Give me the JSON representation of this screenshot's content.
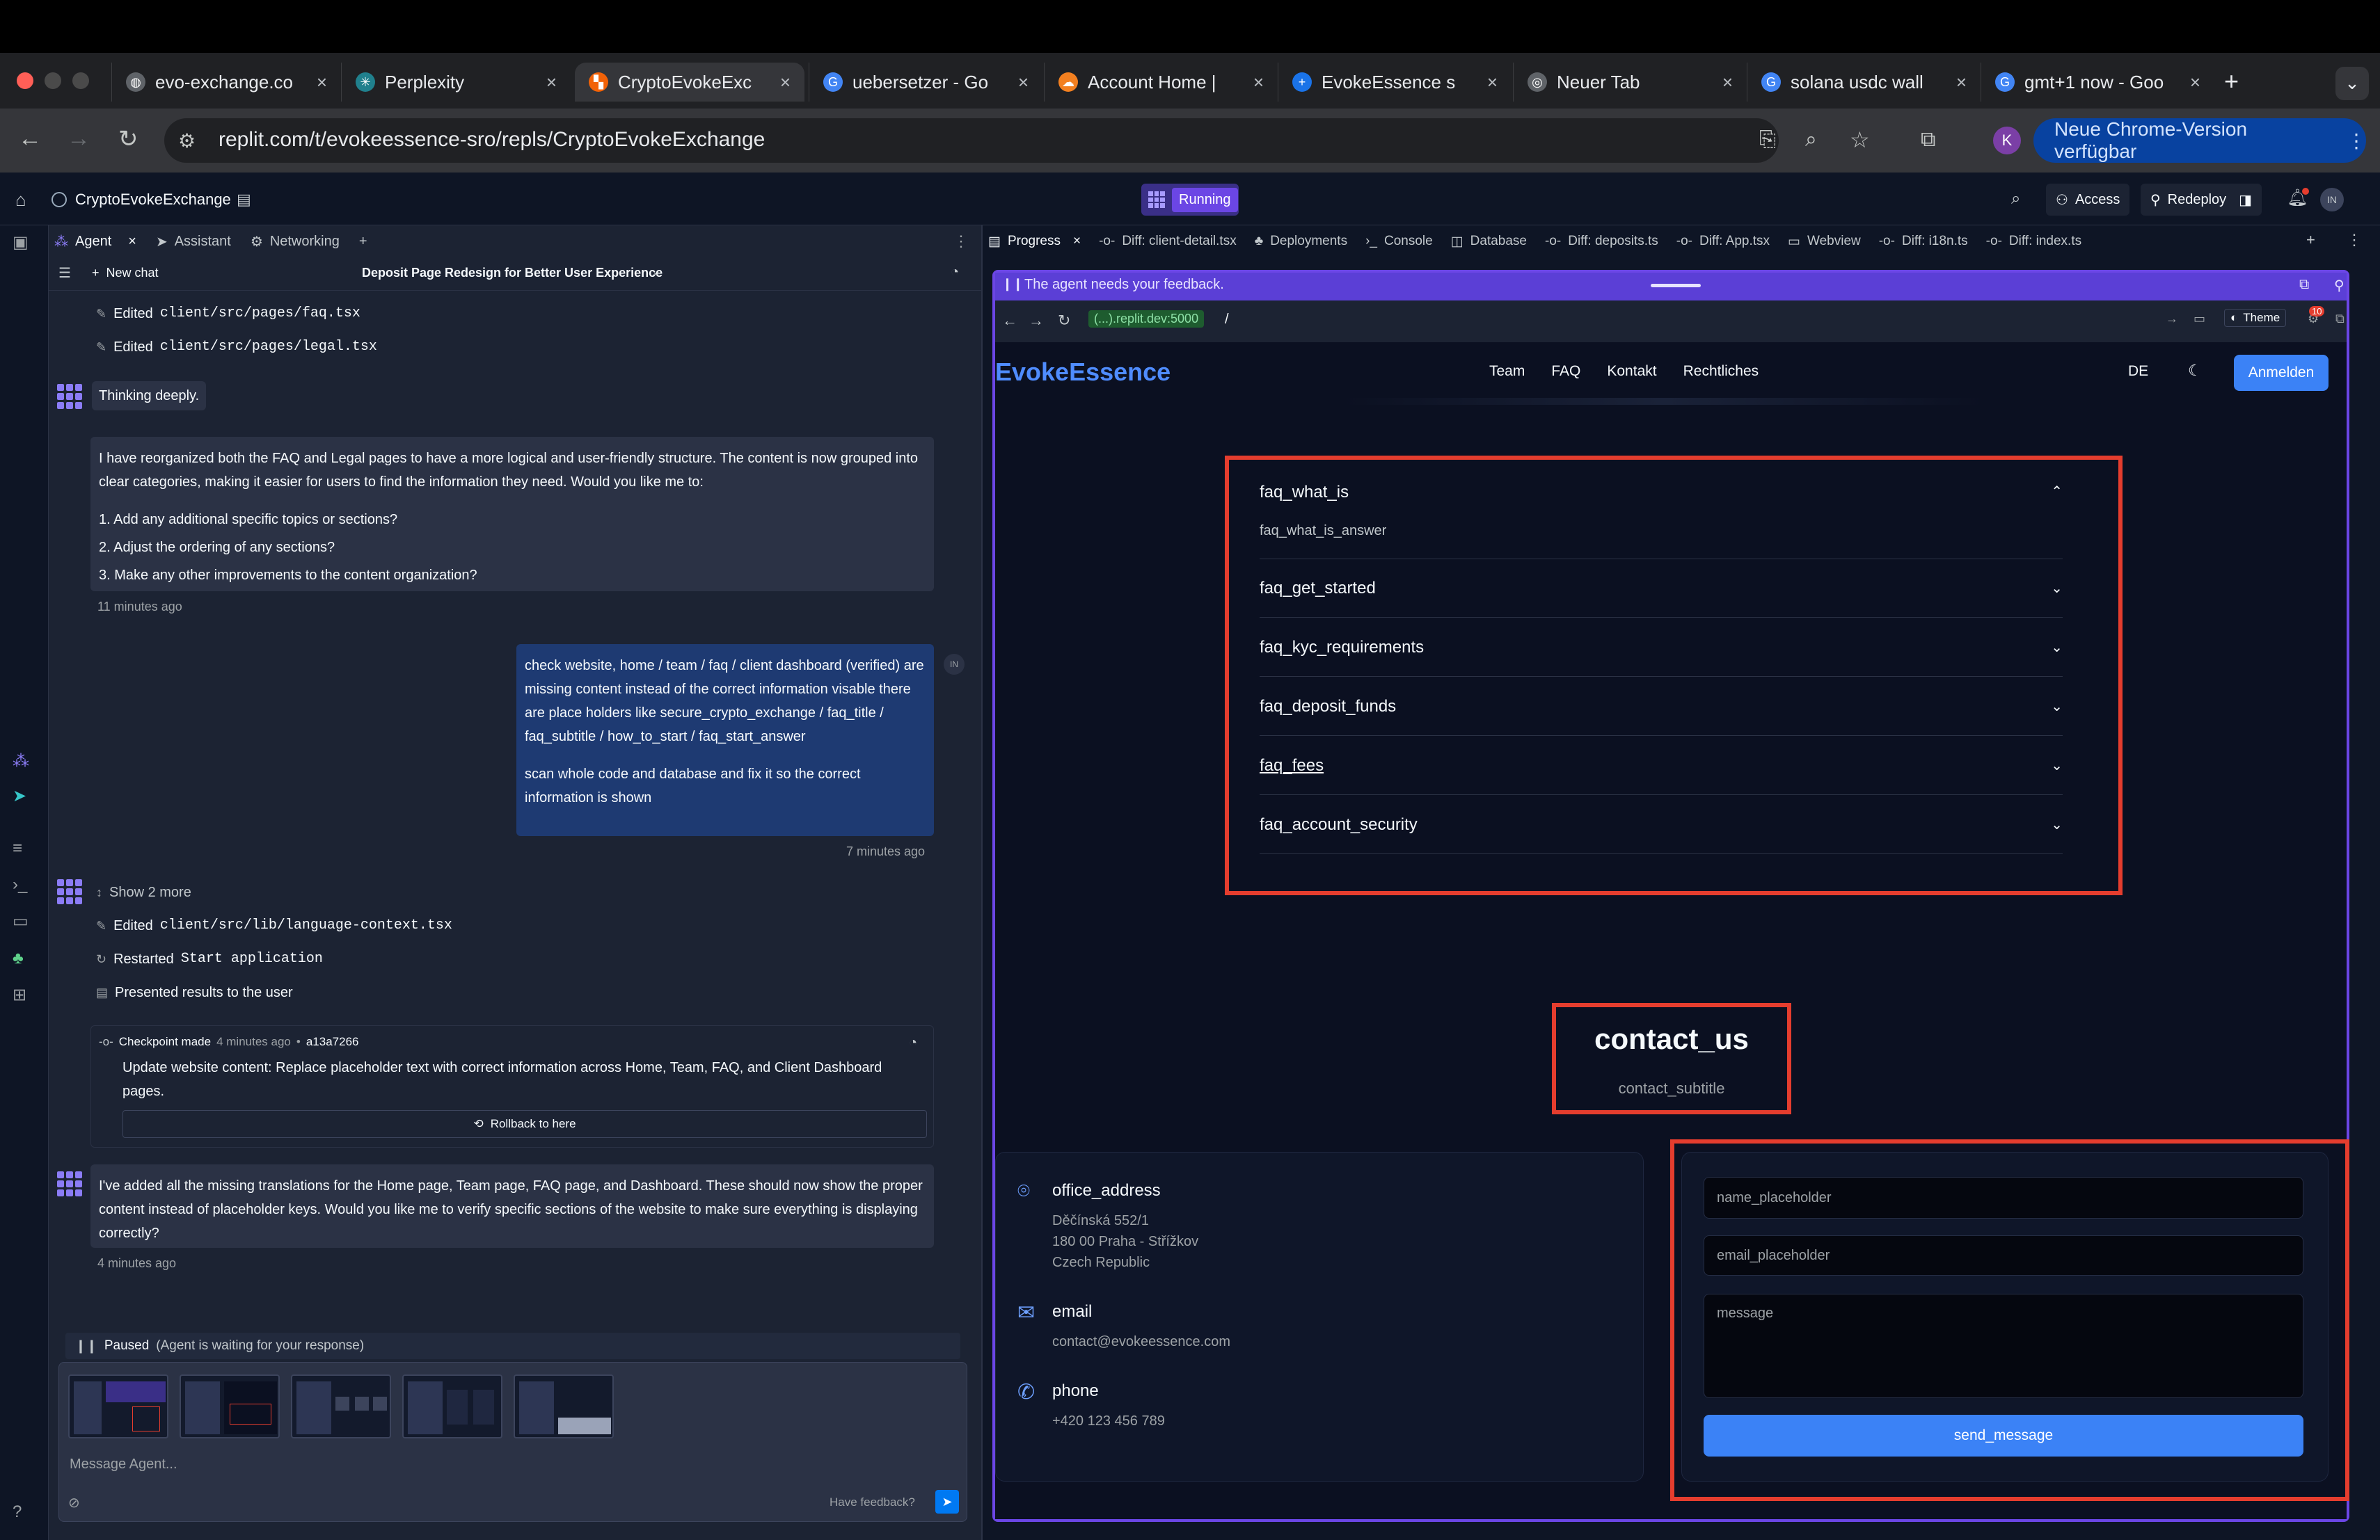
{
  "browser": {
    "tabs": [
      {
        "title": "evo-exchange.co",
        "icon": "globe-icon"
      },
      {
        "title": "Perplexity",
        "icon": "perplexity-icon"
      },
      {
        "title": "CryptoEvokeExc",
        "icon": "replit-icon",
        "active": true
      },
      {
        "title": "uebersetzer - Go",
        "icon": "google-icon"
      },
      {
        "title": "Account Home |",
        "icon": "cloudflare-icon"
      },
      {
        "title": "EvokeEssence s",
        "icon": "plus-icon"
      },
      {
        "title": "Neuer Tab",
        "icon": "chrome-icon"
      },
      {
        "title": "solana usdc wall",
        "icon": "google-icon"
      },
      {
        "title": "gmt+1 now - Goo",
        "icon": "google-icon"
      }
    ],
    "url": "replit.com/t/evokeessence-sro/repls/CryptoEvokeExchange",
    "update_label": "Neue Chrome-Version verfügbar",
    "profile_initial": "K"
  },
  "appbar": {
    "project_name": "CryptoEvokeExchange",
    "run_status": "Running",
    "access_label": "Access",
    "redeploy_label": "Redeploy",
    "user_initials": "IN"
  },
  "left_panel": {
    "tabs": [
      "Agent",
      "Assistant",
      "Networking"
    ],
    "new_chat_label": "New chat",
    "chat_title": "Deposit Page Redesign for Better User Experience"
  },
  "chat": {
    "edited_prefix": "Edited",
    "edited_file_1": "client/src/pages/faq.tsx",
    "edited_file_2": "client/src/pages/legal.tsx",
    "thinking": "Thinking deeply.",
    "agent_msg_1": {
      "intro": "I have reorganized both the FAQ and Legal pages to have a more logical and user-friendly structure. The content is now grouped into clear categories, making it easier for users to find the information they need. Would you like me to:",
      "list_1": "1. Add any additional specific topics or sections?",
      "list_2": "2. Adjust the ordering of any sections?",
      "list_3": "3. Make any other improvements to the content organization?",
      "time": "11 minutes ago"
    },
    "user_msg": {
      "para_1": "check website, home / team / faq / client dashboard (verified) are missing content instead of the correct information visable there are place holders like secure_crypto_exchange / faq_title / faq_subtitle / how_to_start / faq_start_answer",
      "para_2": "scan whole code and database and fix it so the correct information is shown",
      "time": "7 minutes ago",
      "avatar": "IN"
    },
    "show_more": "Show 2 more",
    "edited_file_3": "client/src/lib/language-context.tsx",
    "restarted_prefix": "Restarted",
    "restarted_target": "Start application",
    "presented": "Presented results to the user",
    "checkpoint": {
      "label": "Checkpoint made",
      "time": "4 minutes ago",
      "hash": "a13a7266",
      "text": "Update website content: Replace placeholder text with correct information across Home, Team, FAQ, and Client Dashboard pages.",
      "rollback_label": "Rollback to here"
    },
    "agent_msg_2": {
      "text": "I've added all the missing translations for the Home page, Team page, FAQ page, and Dashboard. These should now show the proper content instead of placeholder keys. Would you like me to verify specific sections of the website to make sure everything is displaying correctly?",
      "time": "4 minutes ago"
    },
    "paused_label": "Paused",
    "paused_detail": "(Agent is waiting for your response)",
    "input_placeholder": "Message Agent...",
    "feedback_label": "Have feedback?"
  },
  "right_panel": {
    "tabs": [
      "Progress",
      "Diff: client-detail.tsx",
      "Deployments",
      "Console",
      "Database",
      "Diff: deposits.ts",
      "Diff: App.tsx",
      "Webview",
      "Diff: i18n.ts",
      "Diff: index.ts"
    ],
    "feedback_banner": "The agent needs your feedback.",
    "webview_url_host": "(...).replit.dev:5000",
    "webview_path": "/",
    "theme_label": "Theme",
    "badge_count": "10"
  },
  "site": {
    "brand": "EvokeEssence",
    "nav": [
      "Team",
      "FAQ",
      "Kontakt",
      "Rechtliches"
    ],
    "lang": "DE",
    "login_label": "Anmelden",
    "faq": [
      {
        "q": "faq_what_is",
        "a": "faq_what_is_answer",
        "open": true
      },
      {
        "q": "faq_get_started"
      },
      {
        "q": "faq_kyc_requirements"
      },
      {
        "q": "faq_deposit_funds"
      },
      {
        "q": "faq_fees"
      },
      {
        "q": "faq_account_security"
      }
    ],
    "contact_title": "contact_us",
    "contact_subtitle": "contact_subtitle",
    "office_title": "office_address",
    "office_address": "Děčínská 552/1\n180 00 Praha - Střížkov\nCzech Republic",
    "email_title": "email",
    "email_value": "contact@evokeessence.com",
    "phone_title": "phone",
    "phone_value": "+420 123 456 789",
    "form": {
      "name_placeholder": "name_placeholder",
      "email_placeholder": "email_placeholder",
      "message_placeholder": "message",
      "submit_label": "send_message"
    }
  },
  "colors": {
    "accent": "#3b82f6",
    "highlight_box": "#e53d2e",
    "feedback_purple": "#5b3fd6",
    "running_badge": "#6b46e5"
  }
}
